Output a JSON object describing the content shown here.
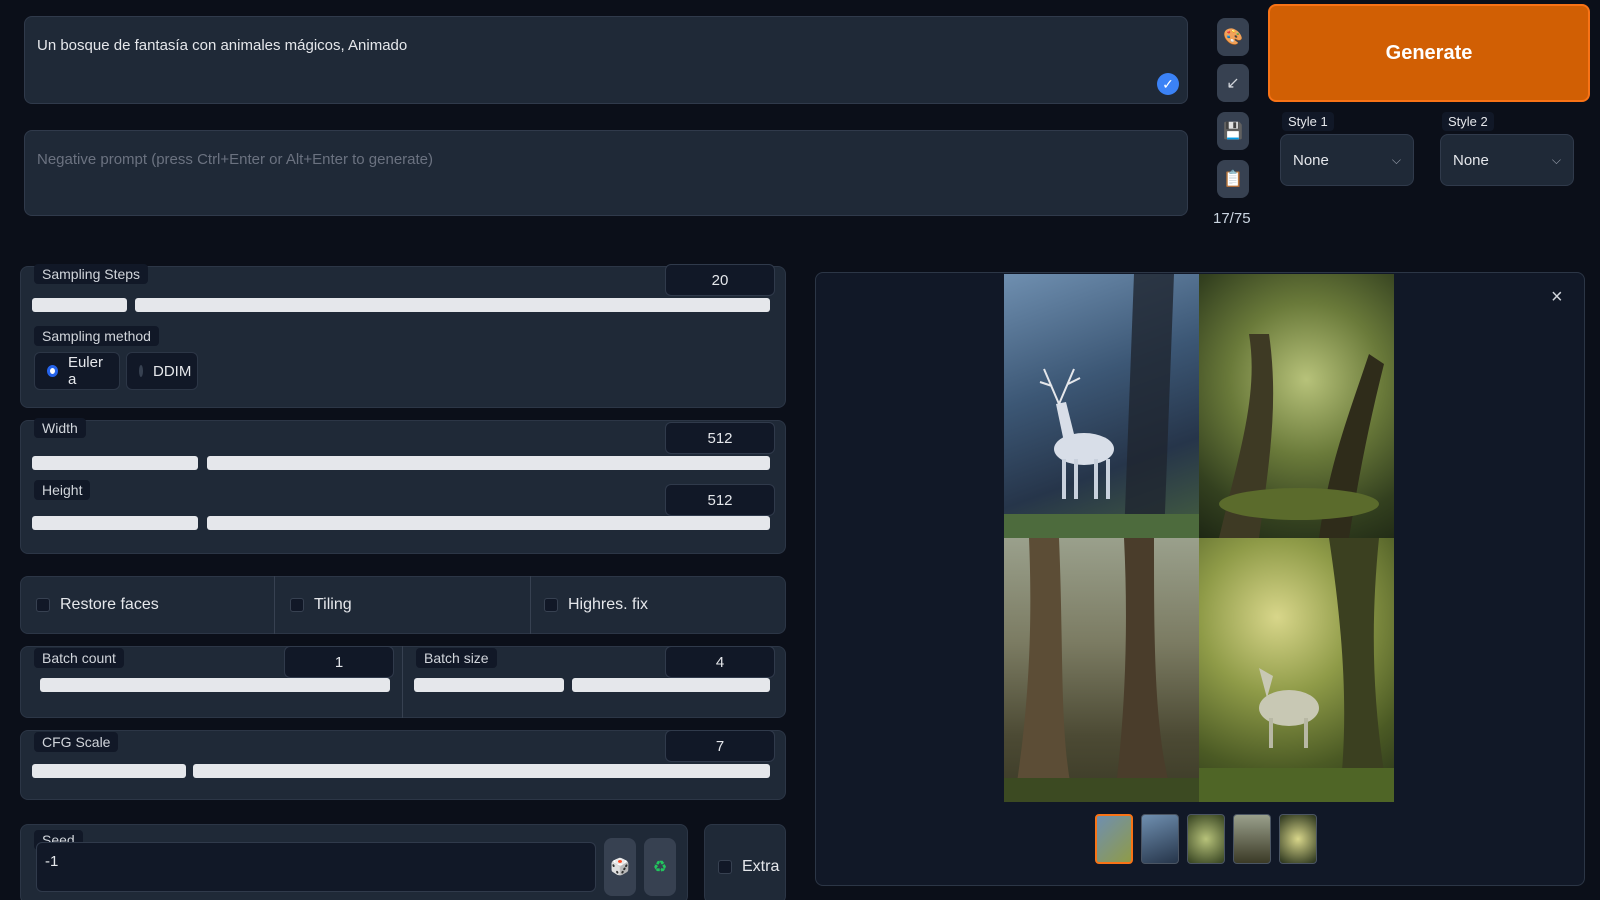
{
  "prompt": {
    "value": "Un bosque de fantasía con animales mágicos, Animado"
  },
  "negative_prompt": {
    "placeholder": "Negative prompt (press Ctrl+Enter or Alt+Enter to generate)"
  },
  "token_counter": "17/75",
  "toolbar_icons": [
    "paint-palette-icon",
    "arrow-check-icon",
    "save-disk-icon",
    "clipboard-icon"
  ],
  "generate": {
    "label": "Generate"
  },
  "styles": [
    {
      "label": "Style 1",
      "value": "None"
    },
    {
      "label": "Style 2",
      "value": "None"
    }
  ],
  "sampling_steps": {
    "label": "Sampling Steps",
    "value": "20"
  },
  "sampling_method": {
    "label": "Sampling method",
    "options": [
      "Euler a",
      "DDIM"
    ],
    "selected": "Euler a"
  },
  "width": {
    "label": "Width",
    "value": "512"
  },
  "height": {
    "label": "Height",
    "value": "512"
  },
  "checkboxes": [
    "Restore faces",
    "Tiling",
    "Highres. fix"
  ],
  "batch_count": {
    "label": "Batch count",
    "value": "1"
  },
  "batch_size": {
    "label": "Batch size",
    "value": "4"
  },
  "cfg_scale": {
    "label": "CFG Scale",
    "value": "7"
  },
  "seed": {
    "label": "Seed",
    "value": "-1"
  },
  "extra": {
    "label": "Extra"
  },
  "gallery": {
    "close_icon": "close-icon",
    "images": 4,
    "thumbnails": 5
  },
  "colors": {
    "accent": "#d15f04",
    "background": "#0b0f19",
    "panel": "#1f2937",
    "radio_selected": "#2563eb"
  }
}
